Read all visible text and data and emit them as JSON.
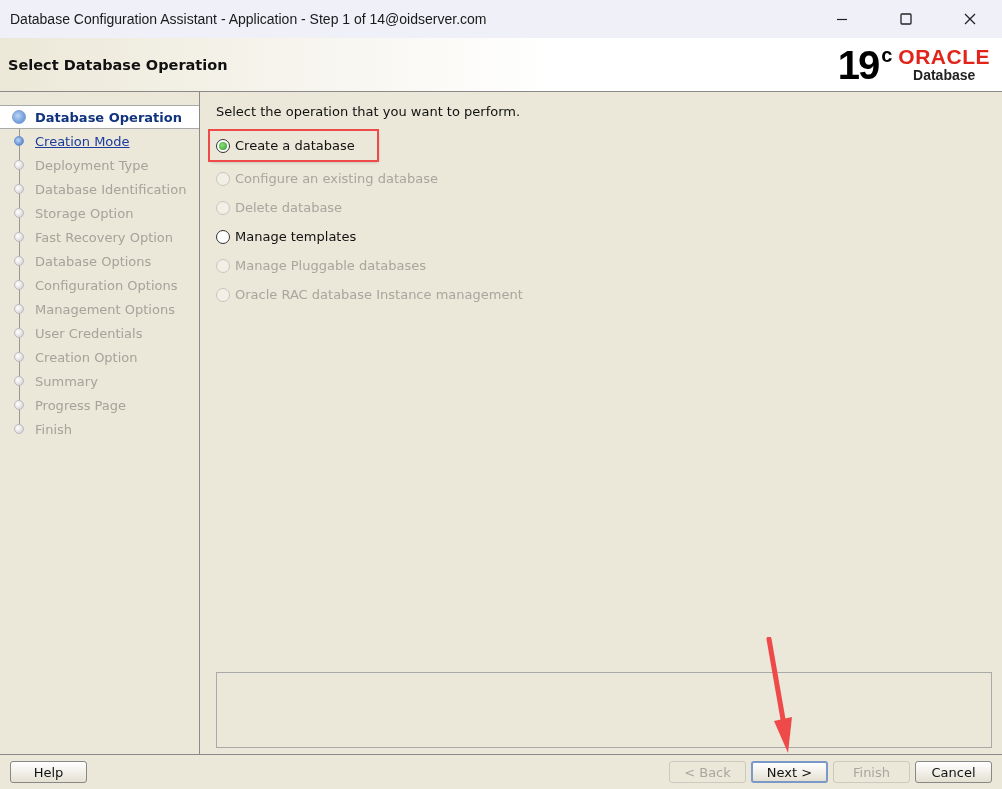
{
  "window": {
    "title": "Database Configuration Assistant - Application - Step 1 of 14@oidserver.com"
  },
  "header": {
    "title": "Select Database Operation",
    "version": "19",
    "version_sup": "c",
    "brand": "ORACLE",
    "product": "Database"
  },
  "steps": [
    {
      "label": "Database Operation",
      "selected": true,
      "disabled": false
    },
    {
      "label": "Creation Mode",
      "selected": false,
      "disabled": false
    },
    {
      "label": "Deployment Type",
      "selected": false,
      "disabled": true
    },
    {
      "label": "Database Identification",
      "selected": false,
      "disabled": true
    },
    {
      "label": "Storage Option",
      "selected": false,
      "disabled": true
    },
    {
      "label": "Fast Recovery Option",
      "selected": false,
      "disabled": true
    },
    {
      "label": "Database Options",
      "selected": false,
      "disabled": true
    },
    {
      "label": "Configuration Options",
      "selected": false,
      "disabled": true
    },
    {
      "label": "Management Options",
      "selected": false,
      "disabled": true
    },
    {
      "label": "User Credentials",
      "selected": false,
      "disabled": true
    },
    {
      "label": "Creation Option",
      "selected": false,
      "disabled": true
    },
    {
      "label": "Summary",
      "selected": false,
      "disabled": true
    },
    {
      "label": "Progress Page",
      "selected": false,
      "disabled": true
    },
    {
      "label": "Finish",
      "selected": false,
      "disabled": true
    }
  ],
  "prompt": "Select the operation that you want to perform.",
  "options": [
    {
      "label": "Create a database",
      "selected": true,
      "disabled": false,
      "highlighted": true
    },
    {
      "label": "Configure an existing database",
      "selected": false,
      "disabled": true,
      "highlighted": false
    },
    {
      "label": "Delete database",
      "selected": false,
      "disabled": true,
      "highlighted": false
    },
    {
      "label": "Manage templates",
      "selected": false,
      "disabled": false,
      "highlighted": false
    },
    {
      "label": "Manage Pluggable databases",
      "selected": false,
      "disabled": true,
      "highlighted": false
    },
    {
      "label": "Oracle RAC database Instance management",
      "selected": false,
      "disabled": true,
      "highlighted": false
    }
  ],
  "help_button": {
    "label": "Help"
  },
  "buttons": [
    {
      "label": "< Back",
      "disabled": true,
      "default": false,
      "pointed": false
    },
    {
      "label": "Next >",
      "disabled": false,
      "default": true,
      "pointed": true
    },
    {
      "label": "Finish",
      "disabled": true,
      "default": false,
      "pointed": false
    },
    {
      "label": "Cancel",
      "disabled": false,
      "default": false,
      "pointed": false
    }
  ]
}
